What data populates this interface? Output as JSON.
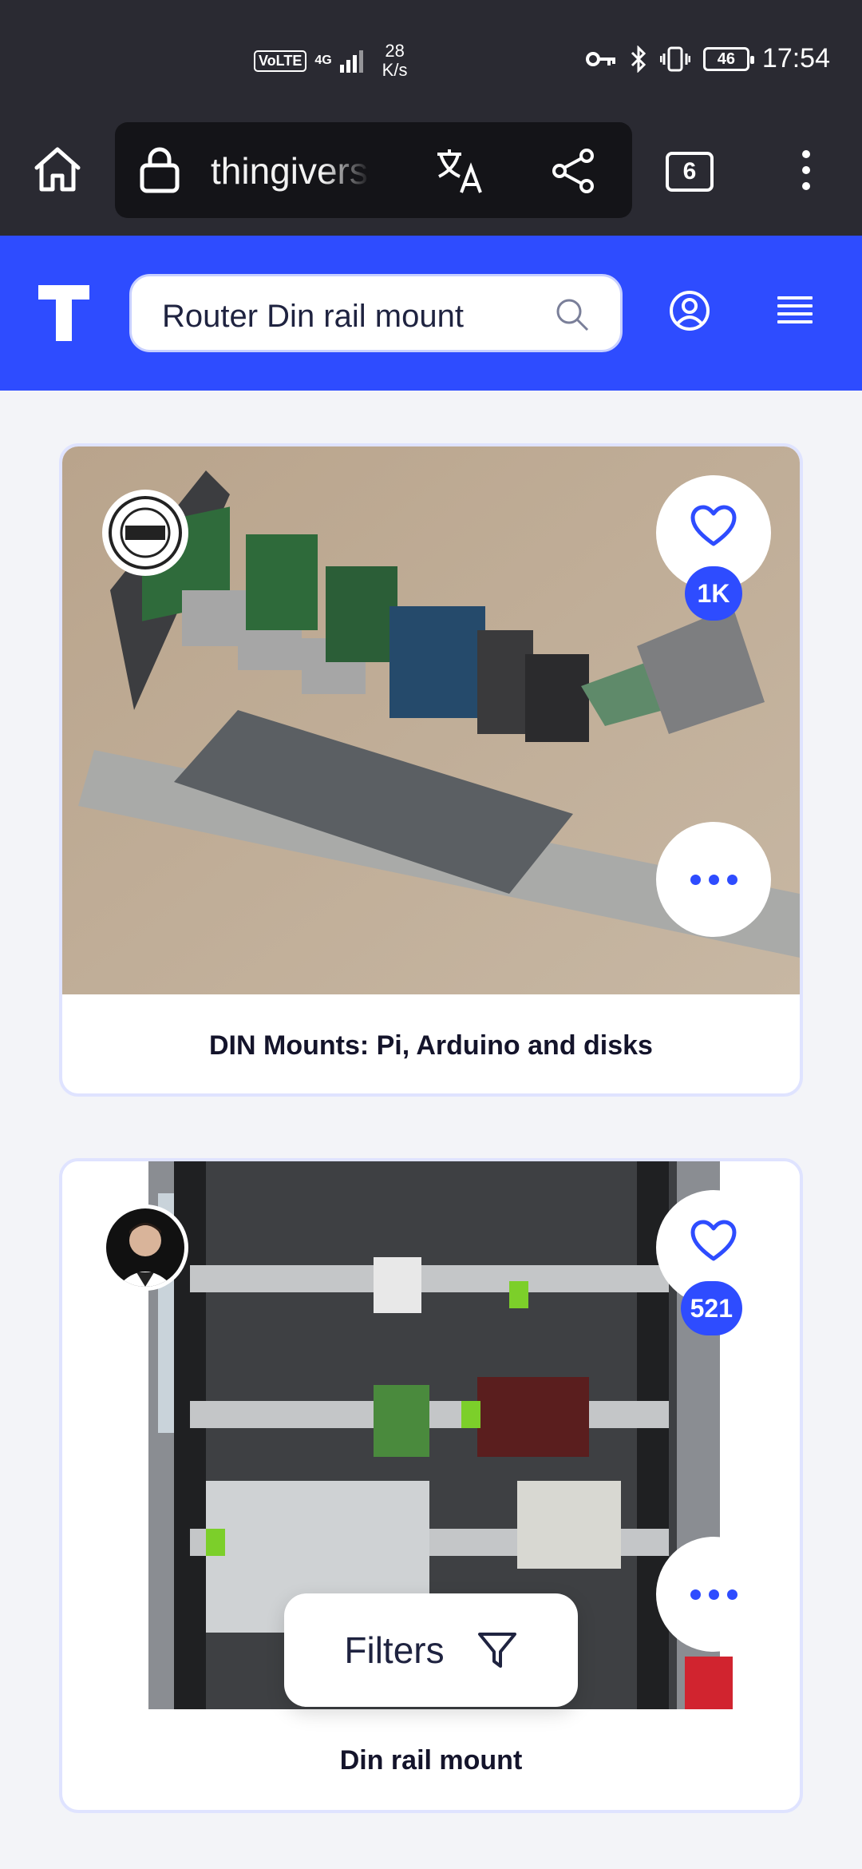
{
  "status_bar": {
    "volte": "VoLTE",
    "network": "4G",
    "speed_value": "28",
    "speed_unit": "K/s",
    "battery": "46",
    "time": "17:54"
  },
  "browser": {
    "url": "thingiverse.com",
    "tab_count": "6"
  },
  "site": {
    "logo_letter": "T",
    "search_value": "Router Din rail mount",
    "brand_color": "#2e4cff"
  },
  "cards": [
    {
      "title": "DIN Mounts: Pi, Arduino and disks",
      "likes": "1K",
      "avatar_icon": "kiss-badge-icon"
    },
    {
      "title": "Din rail mount",
      "likes": "521",
      "avatar_icon": "user-photo"
    }
  ],
  "filters": {
    "label": "Filters"
  }
}
